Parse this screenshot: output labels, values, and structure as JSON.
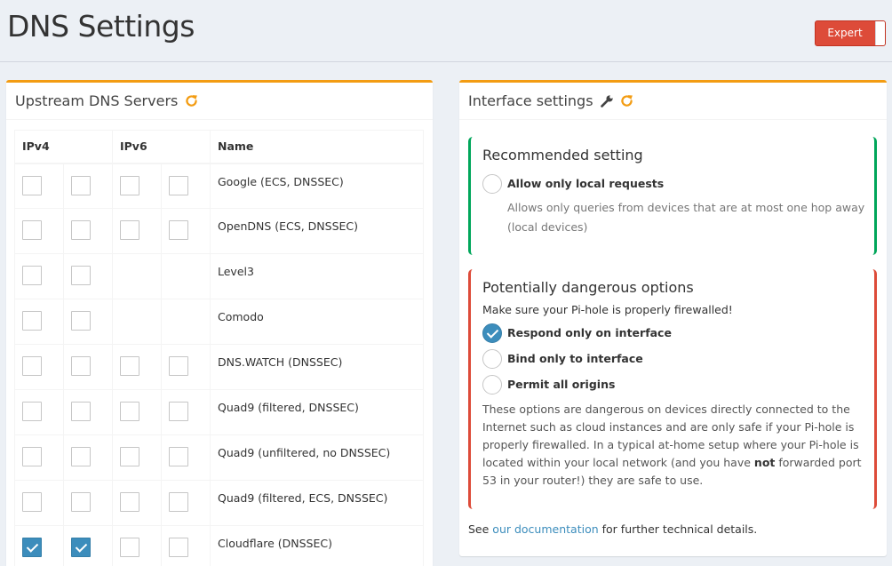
{
  "header": {
    "title": "DNS Settings",
    "expert_label": "Expert"
  },
  "upstream": {
    "title": "Upstream DNS Servers",
    "columns": [
      "IPv4",
      "IPv6",
      "Name"
    ],
    "servers": [
      {
        "name": "Google (ECS, DNSSEC)",
        "ipv4": [
          false,
          false
        ],
        "ipv6": [
          false,
          false
        ]
      },
      {
        "name": "OpenDNS (ECS, DNSSEC)",
        "ipv4": [
          false,
          false
        ],
        "ipv6": [
          false,
          false
        ]
      },
      {
        "name": "Level3",
        "ipv4": [
          false,
          false
        ],
        "ipv6": null
      },
      {
        "name": "Comodo",
        "ipv4": [
          false,
          false
        ],
        "ipv6": null
      },
      {
        "name": "DNS.WATCH (DNSSEC)",
        "ipv4": [
          false,
          false
        ],
        "ipv6": [
          false,
          false
        ]
      },
      {
        "name": "Quad9 (filtered, DNSSEC)",
        "ipv4": [
          false,
          false
        ],
        "ipv6": [
          false,
          false
        ]
      },
      {
        "name": "Quad9 (unfiltered, no DNSSEC)",
        "ipv4": [
          false,
          false
        ],
        "ipv6": [
          false,
          false
        ]
      },
      {
        "name": "Quad9 (filtered, ECS, DNSSEC)",
        "ipv4": [
          false,
          false
        ],
        "ipv6": [
          false,
          false
        ]
      },
      {
        "name": "Cloudflare (DNSSEC)",
        "ipv4": [
          true,
          true
        ],
        "ipv6": [
          false,
          false
        ]
      }
    ]
  },
  "interface": {
    "title": "Interface settings",
    "recommended": {
      "title": "Recommended setting",
      "option_label": "Allow only local requests",
      "option_checked": false,
      "option_desc": "Allows only queries from devices that are at most one hop away (local devices)"
    },
    "dangerous": {
      "title": "Potentially dangerous options",
      "warning": "Make sure your Pi-hole is properly firewalled!",
      "options": [
        {
          "label": "Respond only on interface",
          "checked": true
        },
        {
          "label": "Bind only to interface",
          "checked": false
        },
        {
          "label": "Permit all origins",
          "checked": false
        }
      ],
      "desc_before": "These options are dangerous on devices directly connected to the Internet such as cloud instances and are only safe if your Pi-hole is properly firewalled. In a typical at-home setup where your Pi-hole is located within your local network (and you have ",
      "desc_bold": "not",
      "desc_after": " forwarded port 53 in your router!) they are safe to use."
    },
    "doc": {
      "prefix": "See ",
      "link": "our documentation",
      "suffix": " for further technical details."
    }
  },
  "colors": {
    "accent": "#f39c12",
    "checked": "#3c8dbc",
    "recommended_border": "#00a65a",
    "danger_border": "#dd4b39",
    "expert_button": "#dd4b39"
  }
}
